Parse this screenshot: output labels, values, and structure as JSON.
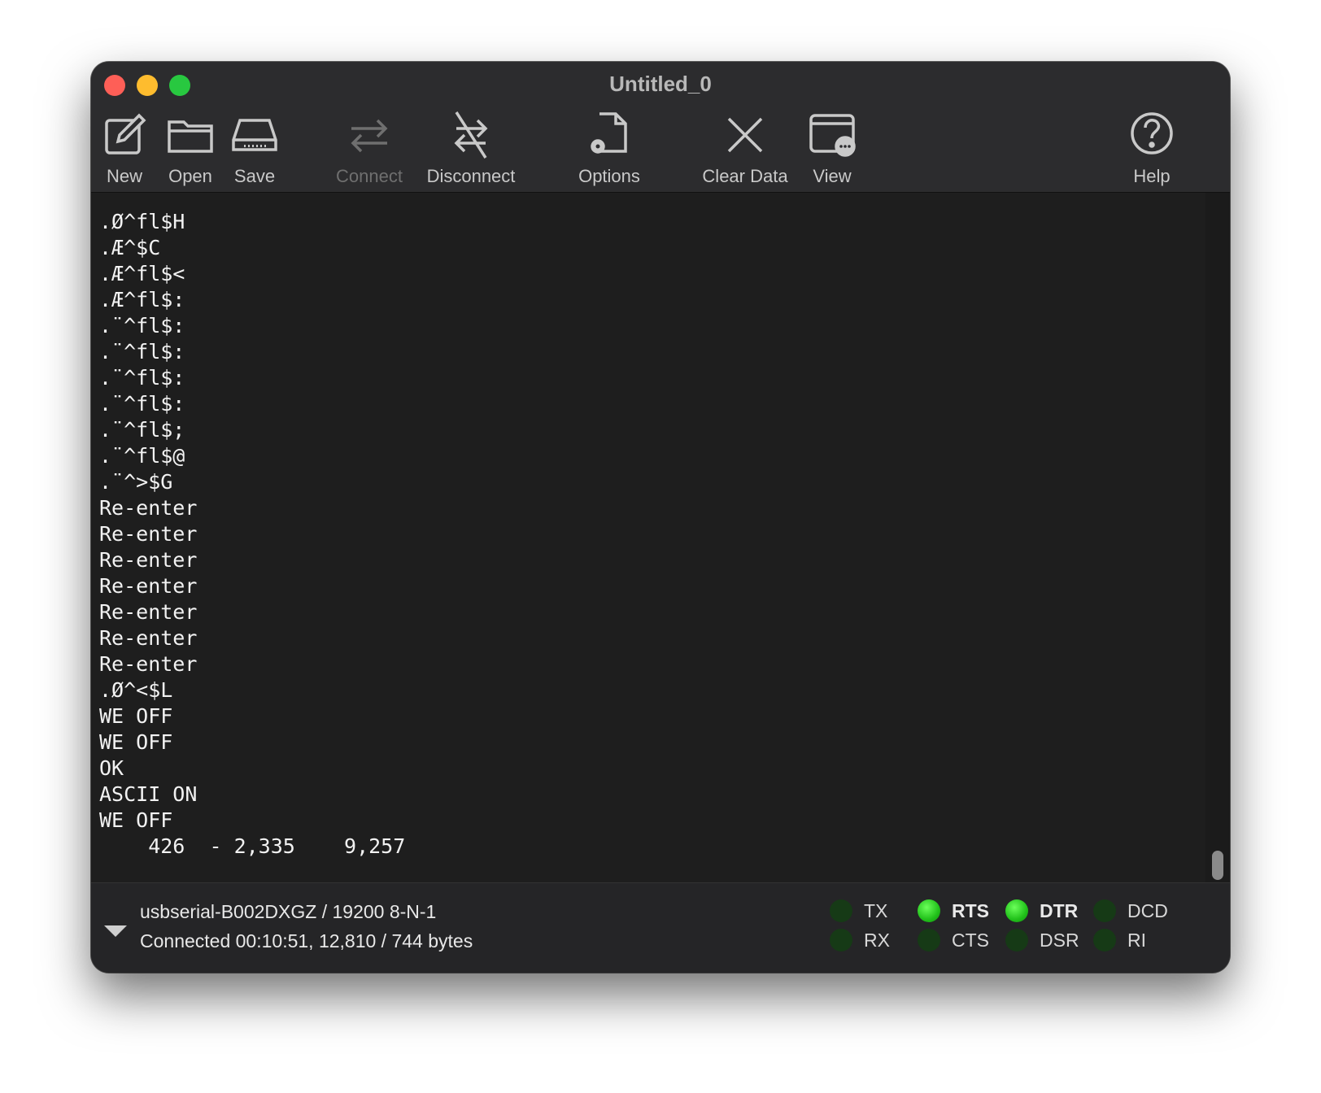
{
  "window": {
    "title": "Untitled_0"
  },
  "toolbar": {
    "new": "New",
    "open": "Open",
    "save": "Save",
    "connect": "Connect",
    "disconnect": "Disconnect",
    "options": "Options",
    "clear_data": "Clear Data",
    "view": "View",
    "help": "Help"
  },
  "terminal": {
    "lines": [
      ".Ø^fl$H",
      ".Æ^$C",
      ".Æ^fl$<",
      ".Æ^fl$:",
      ".¨^fl$:",
      ".¨^fl$:",
      ".¨^fl$:",
      ".¨^fl$:",
      ".¨^fl$;",
      ".¨^fl$@",
      ".¨^>$G",
      "Re-enter",
      "Re-enter",
      "Re-enter",
      "Re-enter",
      "Re-enter",
      "Re-enter",
      "Re-enter",
      ".Ø^<$L",
      "WE OFF",
      "WE OFF",
      "OK",
      "ASCII ON",
      "WE OFF",
      "    426  - 2,335    9,257"
    ]
  },
  "status": {
    "port": "usbserial-B002DXGZ / 19200 8-N-1",
    "connection": "Connected 00:10:51, 12,810 / 744 bytes",
    "signals": {
      "tx": {
        "label": "TX",
        "on": false
      },
      "rx": {
        "label": "RX",
        "on": false
      },
      "rts": {
        "label": "RTS",
        "on": true
      },
      "cts": {
        "label": "CTS",
        "on": false
      },
      "dtr": {
        "label": "DTR",
        "on": true
      },
      "dsr": {
        "label": "DSR",
        "on": false
      },
      "dcd": {
        "label": "DCD",
        "on": false
      },
      "ri": {
        "label": "RI",
        "on": false
      }
    }
  },
  "colors": {
    "led_on": "#22c51a",
    "led_off": "#163a16",
    "terminal_bg": "#1e1e1e",
    "toolbar_bg": "#2c2c2e"
  }
}
